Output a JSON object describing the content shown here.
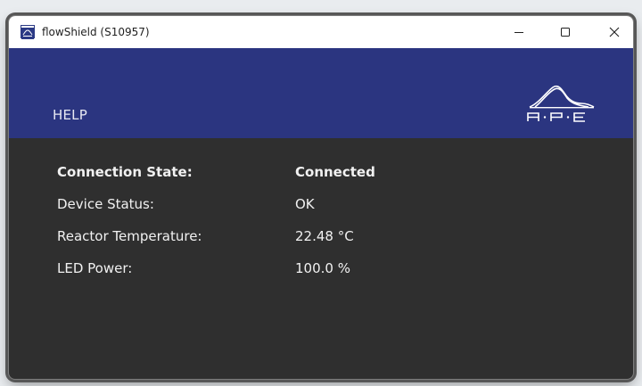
{
  "window": {
    "title": "flowShield (S10957)"
  },
  "header": {
    "help_label": "HELP",
    "logo_text": "A·P·E"
  },
  "status": {
    "rows": [
      {
        "label": "Connection State:",
        "value": "Connected"
      },
      {
        "label": "Device Status:",
        "value": "OK"
      },
      {
        "label": "Reactor Temperature:",
        "value": "22.48 °C"
      },
      {
        "label": "LED Power:",
        "value": "100.0 %"
      }
    ]
  },
  "colors": {
    "header_band": "#2b3580",
    "body_background": "#2f2f2f",
    "text": "#f1f1f1"
  },
  "icons": {
    "app": "ape-app-icon",
    "minimize": "minimize-icon",
    "maximize": "maximize-icon",
    "close": "close-icon",
    "logo": "ape-logo"
  }
}
